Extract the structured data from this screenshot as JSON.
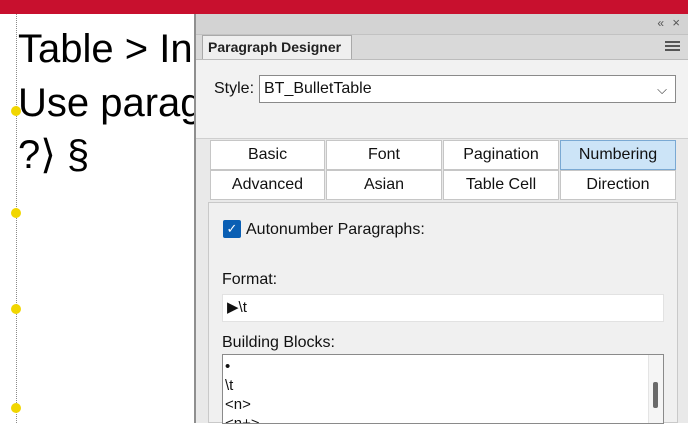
{
  "document": {
    "lines": [
      "Table > In",
      "Use parag",
      "?⟩   §"
    ],
    "accent_color": "#c8102e"
  },
  "panel": {
    "title": "Paragraph Designer",
    "collapse_glyph": "«",
    "close_glyph": "×",
    "menu_icon": "hamburger-menu-icon",
    "style_label": "Style:",
    "style_value": "BT_BulletTable",
    "tabs": [
      {
        "label": "Basic",
        "active": false
      },
      {
        "label": "Font",
        "active": false
      },
      {
        "label": "Pagination",
        "active": false
      },
      {
        "label": "Numbering",
        "active": true
      },
      {
        "label": "Advanced",
        "active": false
      },
      {
        "label": "Asian",
        "active": false
      },
      {
        "label": "Table Cell",
        "active": false
      },
      {
        "label": "Direction",
        "active": false
      }
    ],
    "autonumber": {
      "label": "Autonumber Paragraphs:",
      "checked": true
    },
    "format": {
      "label": "Format:",
      "value": "▶\\t"
    },
    "building_blocks": {
      "label": "Building Blocks:",
      "items": [
        "•",
        "\\t",
        "<n>",
        "<n+>"
      ]
    }
  }
}
